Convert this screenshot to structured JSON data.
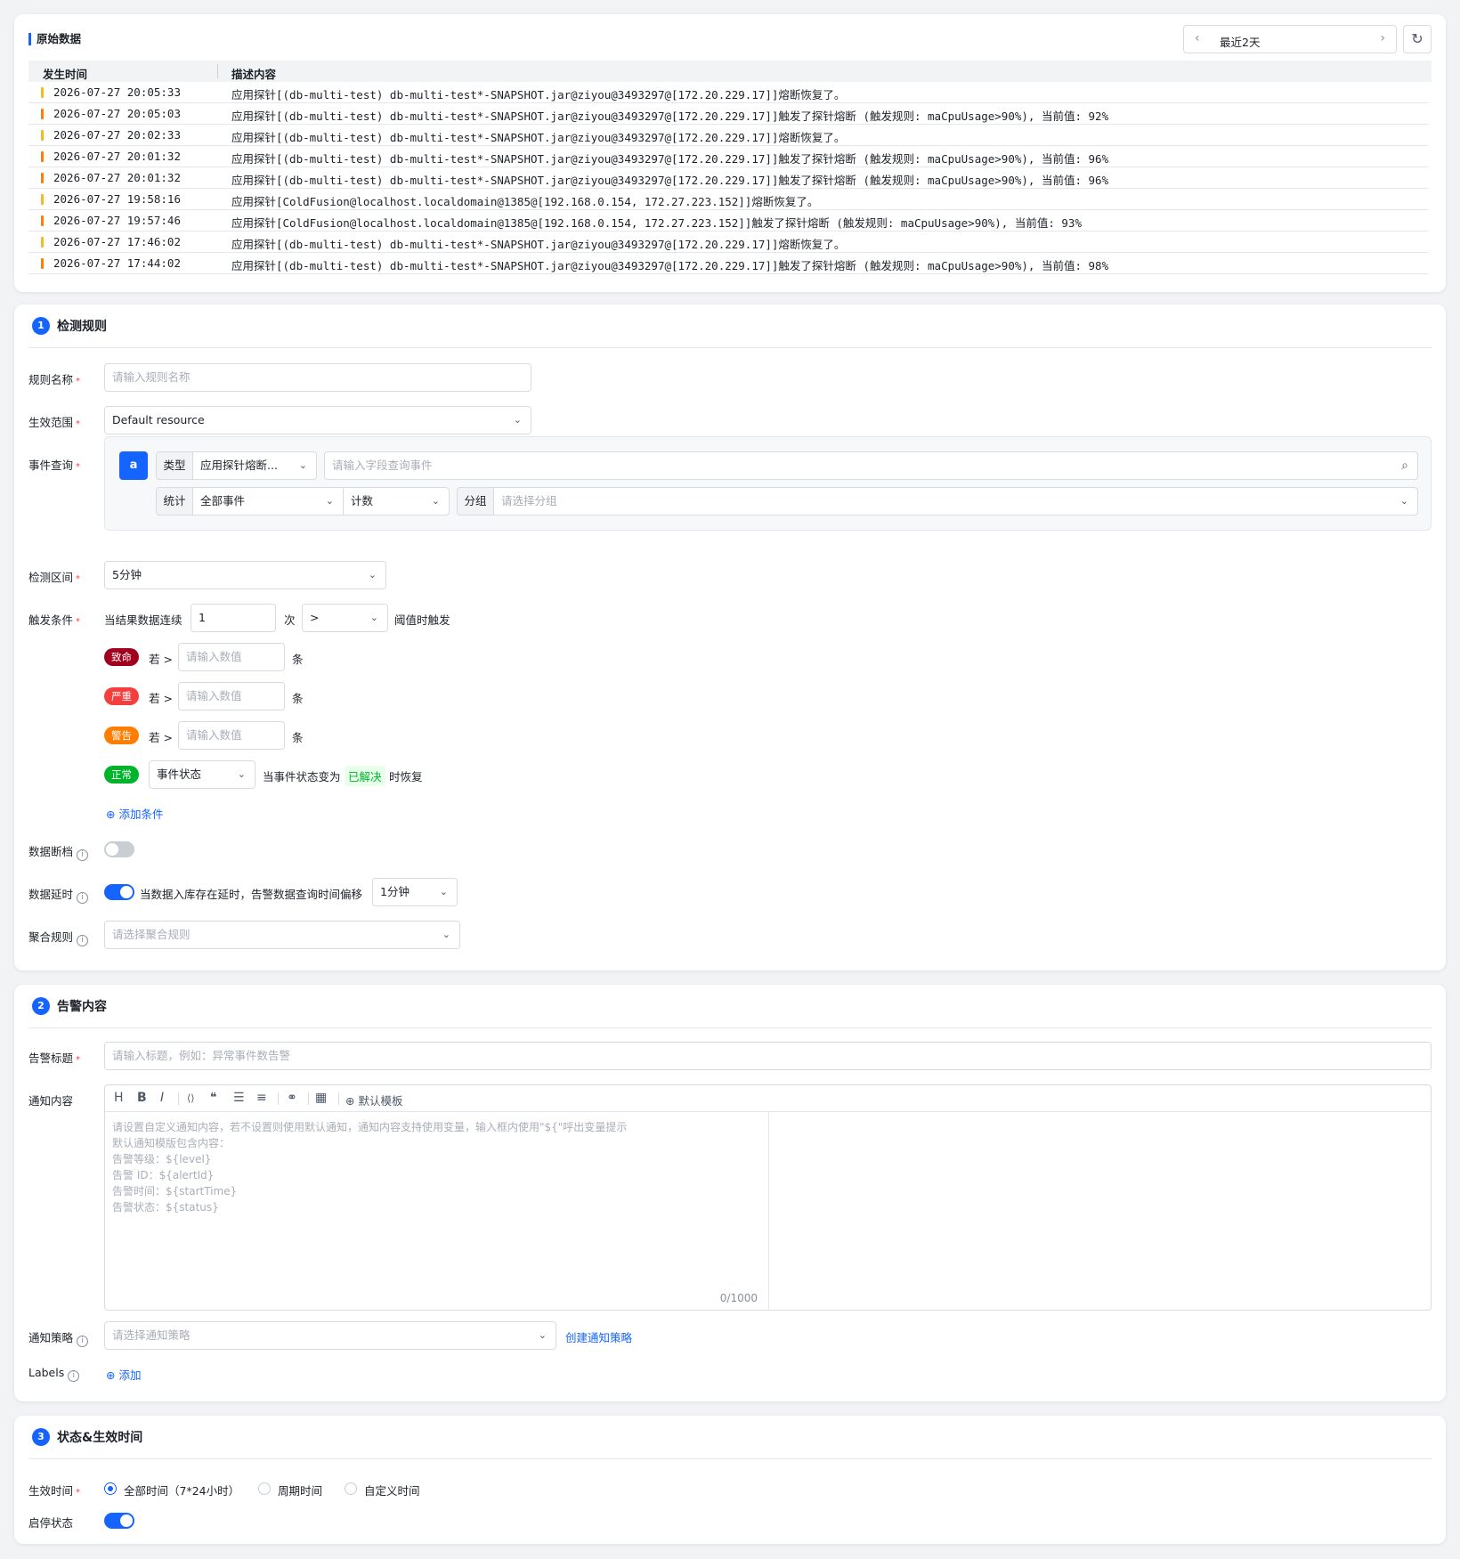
{
  "raw": {
    "title": "原始数据",
    "range_label": "最近2天",
    "columns": [
      "发生时间",
      "描述内容"
    ],
    "rows": [
      {
        "time": "2026-07-27 20:05:33",
        "desc": "应用探针[(db-multi-test) db-multi-test*-SNAPSHOT.jar@ziyou@3493297@[172.20.229.17]]熔断恢复了。",
        "level_color": "#f7ba1e"
      },
      {
        "time": "2026-07-27 20:05:03",
        "desc": "应用探针[(db-multi-test) db-multi-test*-SNAPSHOT.jar@ziyou@3493297@[172.20.229.17]]触发了探针熔断 (触发规则: maCpuUsage>90%), 当前值: 92%",
        "level_color": "#ff7d00"
      },
      {
        "time": "2026-07-27 20:02:33",
        "desc": "应用探针[(db-multi-test) db-multi-test*-SNAPSHOT.jar@ziyou@3493297@[172.20.229.17]]熔断恢复了。",
        "level_color": "#f7ba1e"
      },
      {
        "time": "2026-07-27 20:01:32",
        "desc": "应用探针[(db-multi-test) db-multi-test*-SNAPSHOT.jar@ziyou@3493297@[172.20.229.17]]触发了探针熔断 (触发规则: maCpuUsage>90%), 当前值: 96%",
        "level_color": "#ff7d00"
      },
      {
        "time": "2026-07-27 20:01:32",
        "desc": "应用探针[(db-multi-test) db-multi-test*-SNAPSHOT.jar@ziyou@3493297@[172.20.229.17]]触发了探针熔断 (触发规则: maCpuUsage>90%), 当前值: 96%",
        "level_color": "#ff7d00"
      },
      {
        "time": "2026-07-27 19:58:16",
        "desc": "应用探针[ColdFusion@localhost.localdomain@1385@[192.168.0.154, 172.27.223.152]]熔断恢复了。",
        "level_color": "#f7ba1e"
      },
      {
        "time": "2026-07-27 19:57:46",
        "desc": "应用探针[ColdFusion@localhost.localdomain@1385@[192.168.0.154, 172.27.223.152]]触发了探针熔断 (触发规则: maCpuUsage>90%), 当前值: 93%",
        "level_color": "#ff7d00"
      },
      {
        "time": "2026-07-27 17:46:02",
        "desc": "应用探针[(db-multi-test) db-multi-test*-SNAPSHOT.jar@ziyou@3493297@[172.20.229.17]]熔断恢复了。",
        "level_color": "#f7ba1e"
      },
      {
        "time": "2026-07-27 17:44:02",
        "desc": "应用探针[(db-multi-test) db-multi-test*-SNAPSHOT.jar@ziyou@3493297@[172.20.229.17]]触发了探针熔断 (触发规则: maCpuUsage>90%), 当前值: 98%",
        "level_color": "#ff7d00"
      }
    ]
  },
  "rule": {
    "step": "1",
    "title": "检测规则",
    "name_label": "规则名称",
    "name_placeholder": "请输入规则名称",
    "scope_label": "生效范围",
    "scope_value": "Default resource",
    "query_label": "事件查询",
    "query_letter": "a",
    "type_label": "类型",
    "type_value": "应用探针熔断...",
    "field_placeholder": "请输入字段查询事件",
    "stat_label": "统计",
    "stat_value": "全部事件",
    "agg_value": "计数",
    "group_label": "分组",
    "group_placeholder": "请选择分组",
    "interval_label": "检测区间",
    "interval_value": "5分钟",
    "trigger_label": "触发条件",
    "trigger_prefix": "当结果数据连续",
    "trigger_count": "1",
    "trigger_times": "次",
    "trigger_op": ">",
    "trigger_suffix": "阈值时触发",
    "levels": [
      {
        "tag": "致命",
        "color": "#a1001c",
        "if": "若 >",
        "placeholder": "请输入数值",
        "unit": "条"
      },
      {
        "tag": "严重",
        "color": "#f53f3f",
        "if": "若 >",
        "placeholder": "请输入数值",
        "unit": "条"
      },
      {
        "tag": "警告",
        "color": "#ff7d00",
        "if": "若 >",
        "placeholder": "请输入数值",
        "unit": "条"
      }
    ],
    "normal_tag": "正常",
    "normal_select": "事件状态",
    "normal_text": "当事件状态变为",
    "resolved_tag": "已解决",
    "recover_text": "时恢复",
    "add_condition": "添加条件",
    "break_label": "数据断档",
    "delay_label": "数据延时",
    "delay_text": "当数据入库存在延时，告警数据查询时间偏移",
    "delay_value": "1分钟",
    "merge_label": "聚合规则",
    "merge_placeholder": "请选择聚合规则"
  },
  "content": {
    "step": "2",
    "title": "告警内容",
    "alert_title_label": "告警标题",
    "alert_title_placeholder": "请输入标题，例如：异常事件数告警",
    "notify_label": "通知内容",
    "default_template": "默认模板",
    "editor_placeholder_lines": [
      "请设置自定义通知内容，若不设置则使用默认通知，通知内容支持使用变量，输入框内使用\"${\"呼出变量提示",
      "默认通知模版包含内容：",
      "告警等级：${level}",
      "告警 ID：${alertId}",
      "告警时间：${startTime}",
      "告警状态：${status}"
    ],
    "char_count": "0/1000",
    "policy_label": "通知策略",
    "policy_placeholder": "请选择通知策略",
    "create_policy": "创建通知策略",
    "labels_label": "Labels",
    "add_label": "添加"
  },
  "status": {
    "step": "3",
    "title": "状态&生效时间",
    "time_label": "生效时间",
    "options": [
      "全部时间（7*24小时）",
      "周期时间",
      "自定义时间"
    ],
    "selected": "全部时间（7*24小时）",
    "enable_label": "启停状态",
    "enabled": true
  },
  "colors": {
    "accent": "#1664ff",
    "normal": "#00b42a",
    "resolved_bg": "#e8ffea",
    "resolved_fg": "#00b42a"
  }
}
